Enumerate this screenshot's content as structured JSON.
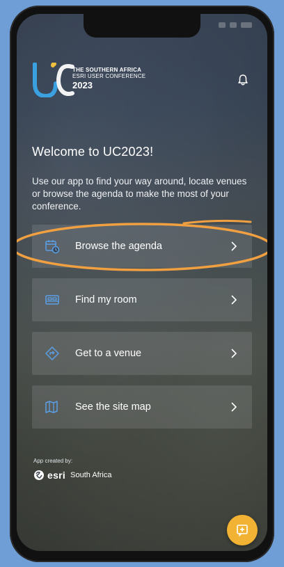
{
  "app": {
    "logo": {
      "line1": "THE SOUTHERN AFRICA",
      "line2": "ESRI USER CONFERENCE",
      "year": "2023"
    },
    "welcome_title": "Welcome to UC2023!",
    "intro_text": "Use our app to find your way around, locate venues or browse the agenda to make the most of your conference.",
    "menu": [
      {
        "label": "Browse the agenda",
        "icon": "calendar-clock-icon"
      },
      {
        "label": "Find my room",
        "icon": "bed-icon"
      },
      {
        "label": "Get to a venue",
        "icon": "navigation-icon"
      },
      {
        "label": "See the site map",
        "icon": "map-icon"
      }
    ],
    "credit": {
      "label": "App created by:",
      "brand": "esri",
      "region": "South Africa"
    }
  },
  "colors": {
    "accent": "#f2b233",
    "highlight_ring": "#f0a040",
    "icon_blue": "#5aa0e8",
    "logo_blue": "#3aa0e0",
    "logo_yellow": "#f2c040"
  }
}
